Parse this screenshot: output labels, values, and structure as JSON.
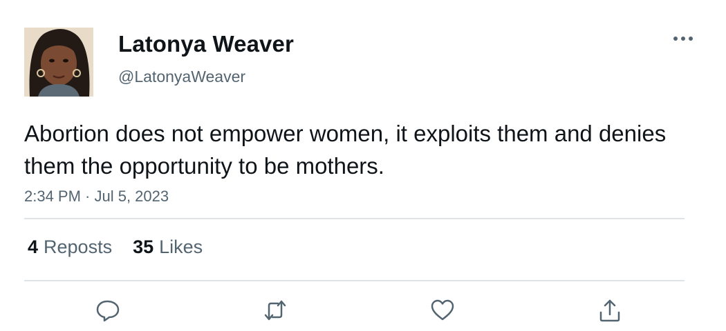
{
  "tweet": {
    "author": {
      "display_name": "Latonya Weaver",
      "handle": "@LatonyaWeaver"
    },
    "text": "Abortion does not empower women, it exploits them and denies them the opportunity to be mothers.",
    "timestamp": "2:34 PM · Jul 5, 2023",
    "stats": {
      "reposts_count": "4",
      "reposts_label": "Reposts",
      "likes_count": "35",
      "likes_label": "Likes"
    },
    "actions": [
      "reply-icon",
      "repost-icon",
      "like-icon",
      "share-icon"
    ],
    "colors": {
      "text": "#0f1419",
      "secondary": "#536471",
      "icon": "#536471",
      "divider": "#dfe3e6"
    }
  }
}
